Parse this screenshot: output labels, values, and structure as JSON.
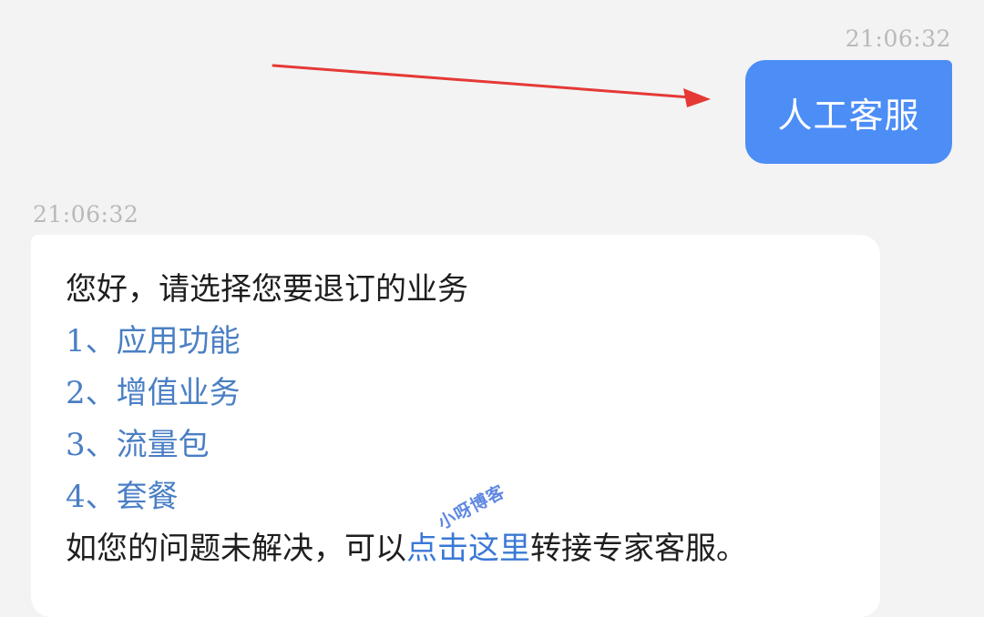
{
  "sent_message": {
    "timestamp": "21:06:32",
    "text": "人工客服"
  },
  "received_message": {
    "timestamp": "21:06:32",
    "greeting": "您好，请选择您要退订的业务",
    "options": [
      {
        "number": "1、",
        "label": "应用功能"
      },
      {
        "number": "2、",
        "label": "增值业务"
      },
      {
        "number": "3、",
        "label": "流量包"
      },
      {
        "number": "4、",
        "label": "套餐"
      }
    ],
    "footer_before": "如您的问题未解决，可以",
    "footer_link": "点击这里",
    "footer_after": "转接专家客服。"
  },
  "watermark": "小呀博客",
  "colors": {
    "background": "#f3f3f3",
    "sent_bubble": "#4c8df6",
    "option_text": "#4a7fc4",
    "link_text": "#3a78d6",
    "annotation_arrow": "#e53935"
  }
}
